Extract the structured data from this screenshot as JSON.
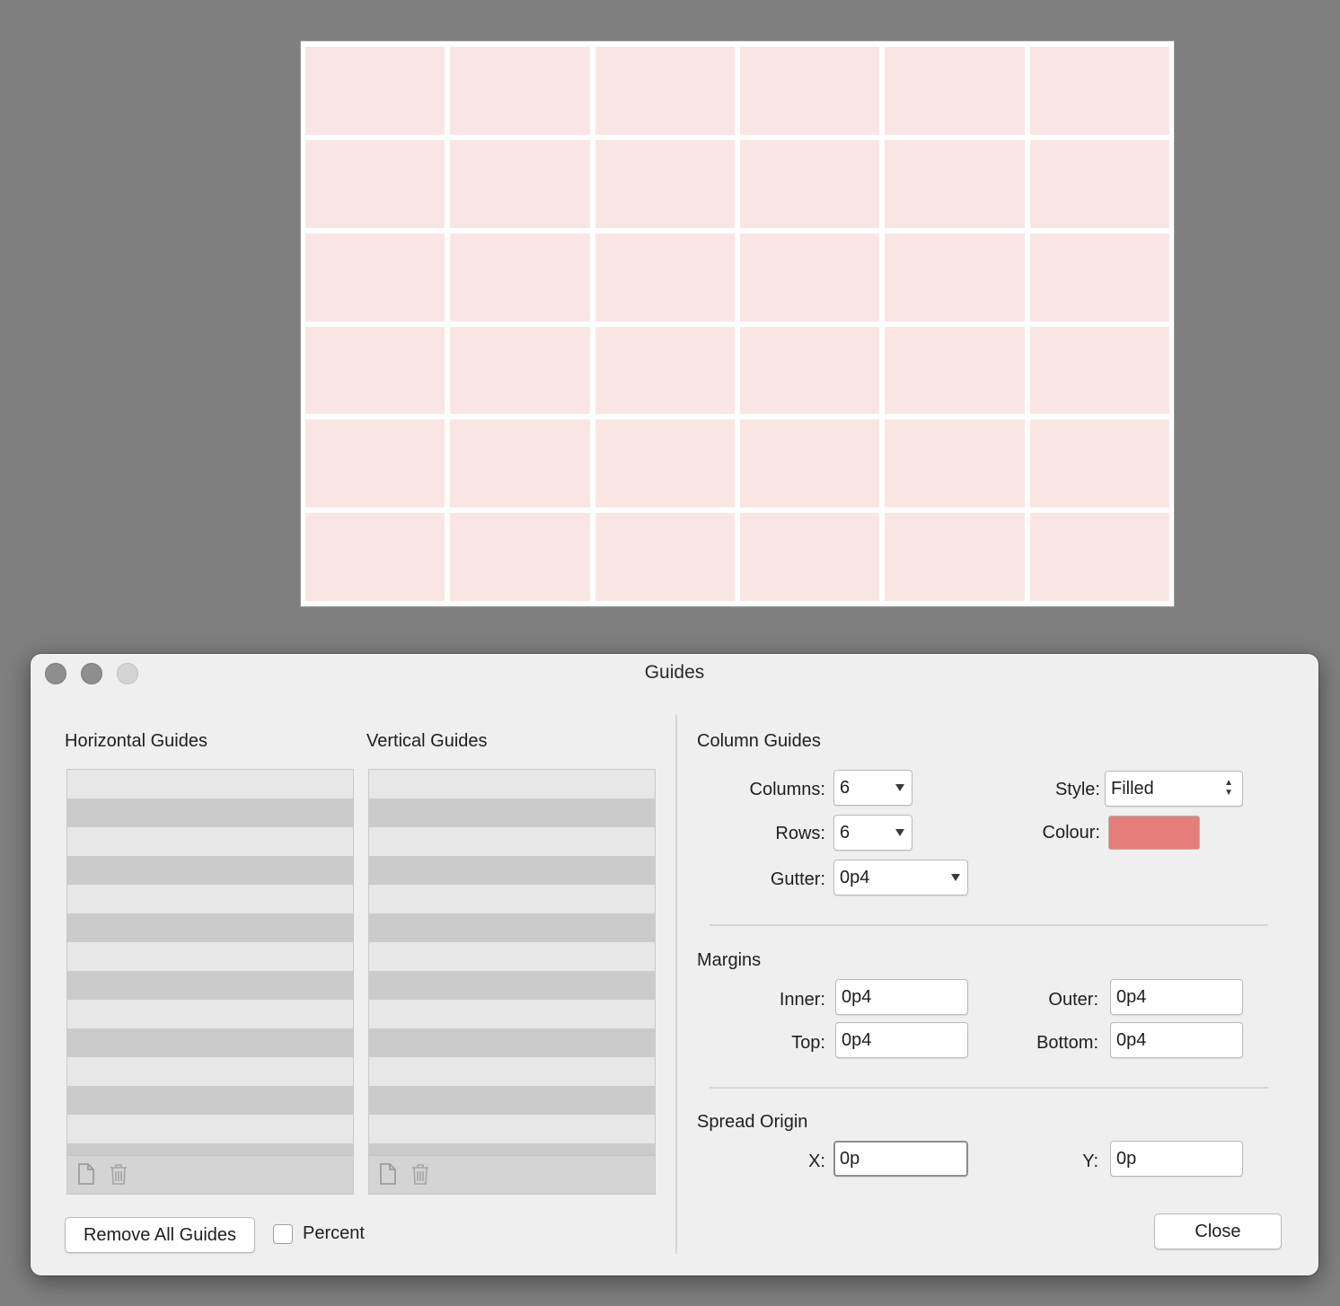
{
  "canvas": {
    "columns": 6,
    "rows": 6
  },
  "dialog": {
    "title": "Guides",
    "horizontal_guides": {
      "label": "Horizontal Guides",
      "items": []
    },
    "vertical_guides": {
      "label": "Vertical Guides",
      "items": []
    },
    "column_guides": {
      "label": "Column Guides",
      "columns_label": "Columns:",
      "columns_value": "6",
      "rows_label": "Rows:",
      "rows_value": "6",
      "gutter_label": "Gutter:",
      "gutter_value": "0p4",
      "style_label": "Style:",
      "style_value": "Filled",
      "colour_label": "Colour:",
      "colour_value": "#e57d7a"
    },
    "margins": {
      "label": "Margins",
      "inner_label": "Inner:",
      "inner_value": "0p4",
      "outer_label": "Outer:",
      "outer_value": "0p4",
      "top_label": "Top:",
      "top_value": "0p4",
      "bottom_label": "Bottom:",
      "bottom_value": "0p4"
    },
    "spread_origin": {
      "label": "Spread Origin",
      "x_label": "X:",
      "x_value": "0p",
      "y_label": "Y:",
      "y_value": "0p"
    },
    "remove_all_label": "Remove All Guides",
    "percent_label": "Percent",
    "close_label": "Close"
  },
  "icons": {
    "add": "new-page-icon",
    "delete": "trash-icon"
  }
}
